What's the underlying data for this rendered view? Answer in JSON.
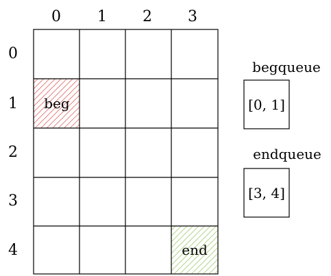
{
  "grid": {
    "rows": 5,
    "cols": 4,
    "col_labels": [
      "0",
      "1",
      "2",
      "3"
    ],
    "row_labels": [
      "0",
      "1",
      "2",
      "3",
      "4"
    ],
    "cells": [
      {
        "row": 1,
        "col": 0,
        "label": "beg",
        "pattern": "hatch-red"
      },
      {
        "row": 4,
        "col": 3,
        "label": "end",
        "pattern": "hatch-green"
      }
    ]
  },
  "queues": [
    {
      "title": "begqueue",
      "value": "[0, 1]"
    },
    {
      "title": "endqueue",
      "value": "[3, 4]"
    }
  ],
  "colors": {
    "line": "#000000",
    "hatch_red": "#d9534f",
    "hatch_green": "#8cc152"
  }
}
